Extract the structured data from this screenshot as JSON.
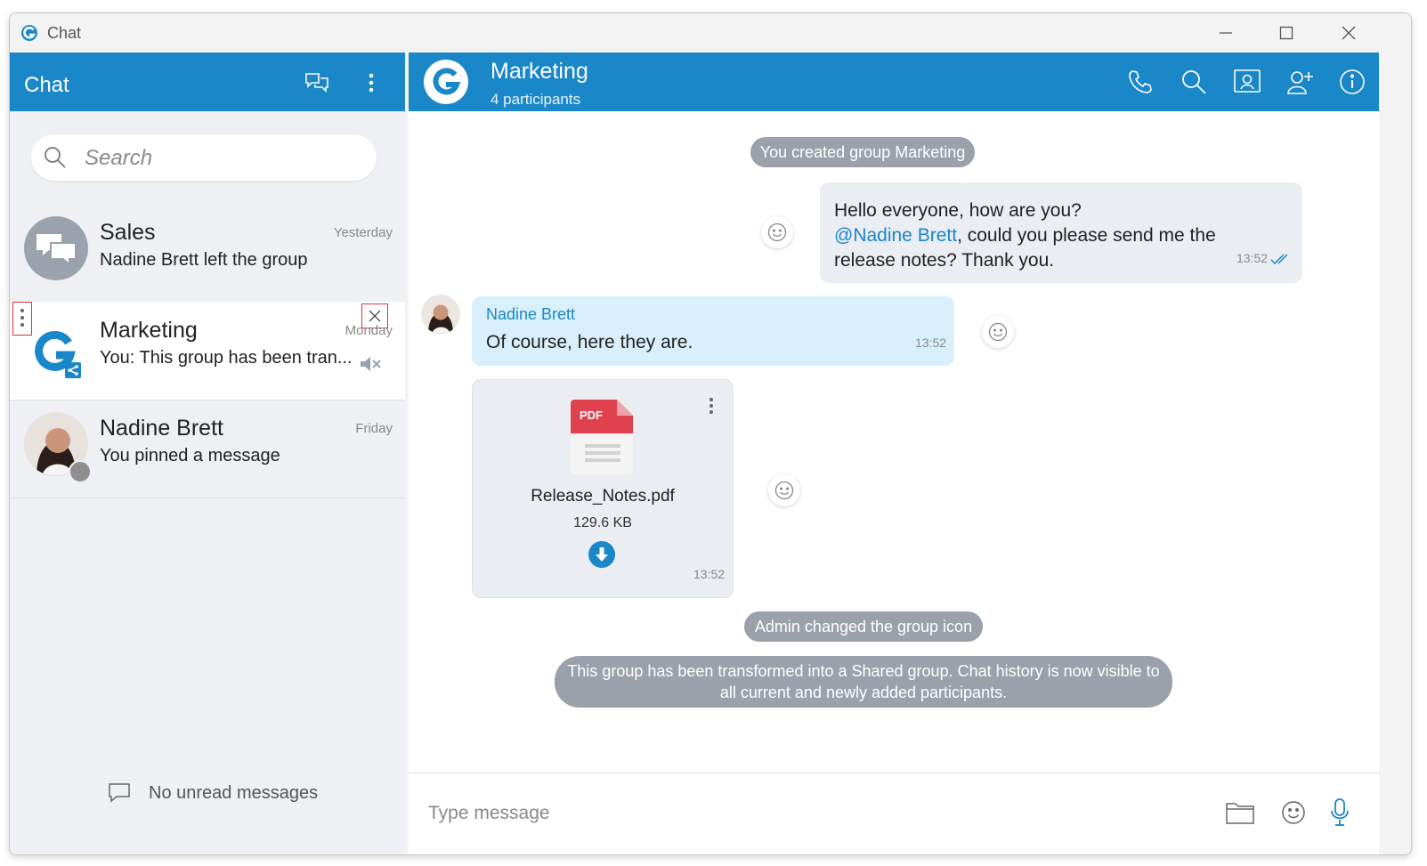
{
  "window": {
    "title": "Chat"
  },
  "sidebar": {
    "title": "Chat",
    "search_placeholder": "Search",
    "conversations": [
      {
        "name": "Sales",
        "time": "Yesterday",
        "preview": "Nadine Brett left the group"
      },
      {
        "name": "Marketing",
        "time": "Monday",
        "preview": "You: This group has been tran..."
      },
      {
        "name": "Nadine Brett",
        "time": "Friday",
        "preview": "You pinned a message"
      }
    ],
    "footer": "No unread messages"
  },
  "chat": {
    "group_name": "Marketing",
    "participants": "4 participants",
    "system_created": "You created group Marketing",
    "outgoing": {
      "line1": "Hello everyone, how are you?",
      "mention": "@Nadine Brett",
      "line2": ", could you please send me the",
      "line3": "release notes? Thank you.",
      "time": "13:52"
    },
    "incoming": {
      "sender": "Nadine Brett",
      "text": "Of course, here they are.",
      "time": "13:52"
    },
    "file": {
      "type_label": "PDF",
      "name": "Release_Notes.pdf",
      "size": "129.6 KB",
      "time": "13:52"
    },
    "system_icon": "Admin changed the group icon",
    "system_shared": "This group has been transformed into a Shared group. Chat history is now visible to all current and newly added participants.",
    "composer_placeholder": "Type message"
  },
  "colors": {
    "brand": "#1a87c9",
    "system_pill": "#9ba1ab",
    "incoming_bubble": "#d9effc",
    "outgoing_bubble": "#eaedf1",
    "pdf_red": "#e0414f"
  },
  "icons": {
    "app": "app-logo-icon",
    "minimize": "minimize-icon",
    "maximize": "maximize-icon",
    "close": "close-icon",
    "new_chat": "new-chat-icon",
    "more": "more-vertical-icon",
    "search": "search-icon",
    "mute": "mute-icon",
    "call": "phone-icon",
    "info": "info-icon",
    "attach": "folder-icon",
    "emoji": "emoji-icon",
    "mic": "microphone-icon"
  }
}
